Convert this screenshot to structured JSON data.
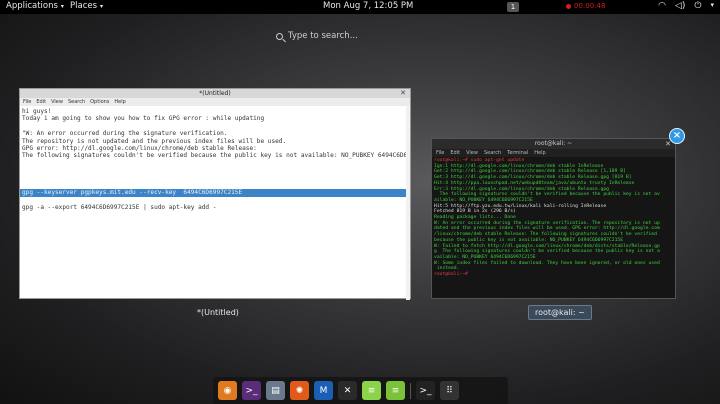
{
  "topbar": {
    "applications": "Applications",
    "places": "Places",
    "clock": "Mon Aug  7, 12:05 PM",
    "workspace": "1",
    "recording": "00:00:48"
  },
  "search": {
    "placeholder": "Type to search..."
  },
  "editor": {
    "title": "*(Untitled)",
    "menu": [
      "File",
      "Edit",
      "View",
      "Search",
      "Options",
      "Help"
    ],
    "lines": [
      "hi guys!",
      "Today i am going to show you how to fix GPG error : while updating",
      "",
      "\"W: An error occurred during the signature verification.",
      "The repository is not updated and the previous index files will be used.",
      "GPG error: http://dl.google.com/linux/chrome/deb stable Release:",
      "The following signatures couldn't be verified because the public key is not available: NO_PUBKEY 6494C6D6997C215E",
      "",
      "",
      "",
      "",
      "gpg --keyserver pgpkeys.mit.edu --recv-key  6494C6D6997C215E",
      "",
      "gpg -a --export 6494C6D6997C215E | sudo apt-key add -"
    ],
    "highlight_line": 11,
    "taskbar_label": "*(Untitled)"
  },
  "terminal": {
    "title": "root@kali: ~",
    "menu": [
      "File",
      "Edit",
      "View",
      "Search",
      "Terminal",
      "Help"
    ],
    "lines": [
      "root@kali:~# sudo apt-get update",
      "Ign:1 http://dl.google.com/linux/chrome/deb stable InRelease",
      "Get:2 http://dl.google.com/linux/chrome/deb stable Release [1,189 B]",
      "Get:3 http://dl.google.com/linux/chrome/deb stable Release.gpg [819 B]",
      "Hit:4 http://ppa.launchpad.net/webupd8team/java/ubuntu trusty InRelease",
      "Err:3 http://dl.google.com/linux/chrome/deb stable Release.gpg",
      "  The following signatures couldn't be verified because the public key is not av",
      "ailable: NO_PUBKEY 6494C6D6997C215E",
      "Hit:5 http://ftp.yzu.edu.tw/Linux/kali kali-rolling InRelease",
      "Fetched 819 B in 2s (296 B/s)",
      "Reading package lists... Done",
      "W: An error occurred during the signature verification. The repository is not up",
      "dated and the previous index files will be used. GPG error: http://dl.google.com",
      "/linux/chrome/deb stable Release: The following signatures couldn't be verified",
      "because the public key is not available: NO_PUBKEY 6494C6D6997C215E",
      "W: Failed to fetch http://dl.google.com/linux/chrome/deb/dists/stable/Release.gp",
      "g  The following signatures couldn't be verified because the public key is not a",
      "vailable: NO_PUBKEY 6494C6D6997C215E",
      "W: Some index files failed to download. They have been ignored, or old ones used",
      " instead.",
      "root@kali:~# "
    ],
    "taskbar_label": "root@kali: ~"
  },
  "dock": {
    "apps": [
      {
        "icon": "firefox-icon",
        "color": "#e07a1f",
        "glyph": "◉"
      },
      {
        "icon": "terminal-icon",
        "color": "#5a2d7a",
        "glyph": ">_"
      },
      {
        "icon": "files-icon",
        "color": "#6a7a8c",
        "glyph": "▤"
      },
      {
        "icon": "burpsuite-icon",
        "color": "#e05a1a",
        "glyph": "✺"
      },
      {
        "icon": "metasploit-icon",
        "color": "#1a5fb4",
        "glyph": "M"
      },
      {
        "icon": "kali-tools-icon",
        "color": "#2a2a2a",
        "glyph": "✕"
      },
      {
        "icon": "text-editor-icon",
        "color": "#8bd449",
        "glyph": "≡"
      },
      {
        "icon": "text-editor-alt-icon",
        "color": "#7ac23a",
        "glyph": "≡"
      },
      {
        "icon": "terminal-small-icon",
        "color": "#222",
        "glyph": ">_"
      },
      {
        "icon": "app-grid-icon",
        "color": "#333",
        "glyph": "⠿"
      }
    ]
  }
}
